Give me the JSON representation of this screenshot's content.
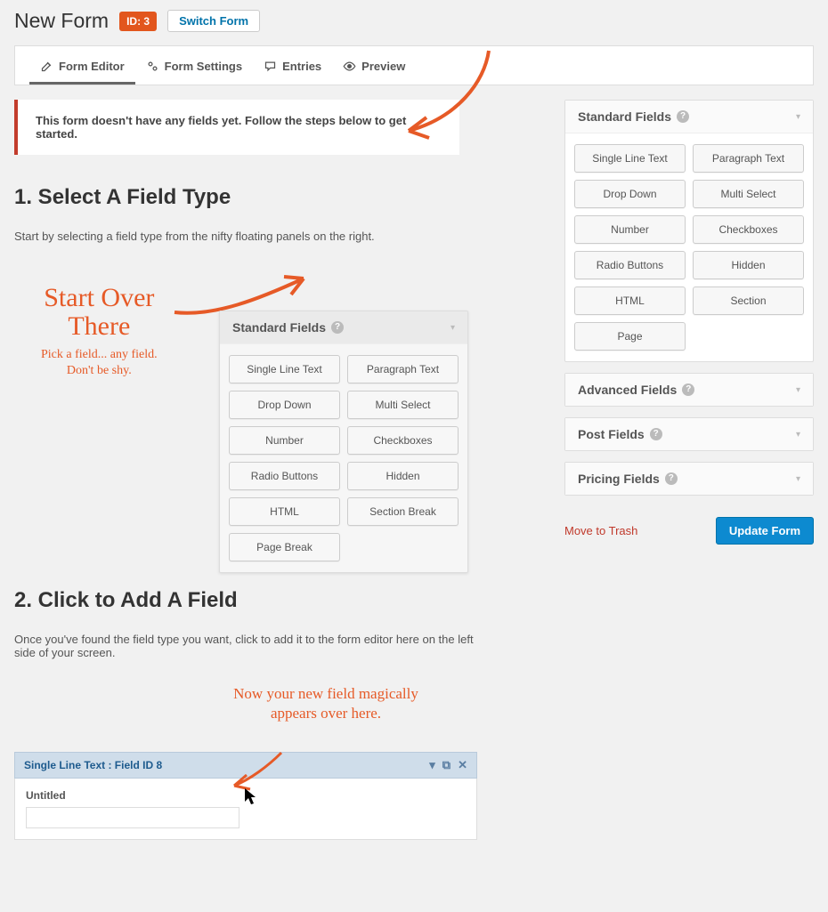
{
  "header": {
    "title": "New Form",
    "id_badge": "ID: 3",
    "switch_form": "Switch Form"
  },
  "tabs": {
    "editor": "Form Editor",
    "settings": "Form Settings",
    "entries": "Entries",
    "preview": "Preview"
  },
  "notice": "This form doesn't have any fields yet. Follow the steps below to get started.",
  "step1": {
    "heading": "1. Select A Field Type",
    "desc": "Start by selecting a field type from the nifty floating panels on the right.",
    "hand_big1": "Start Over",
    "hand_big2": "There",
    "hand_small1": "Pick a field... any field.",
    "hand_small2": "Don't be shy."
  },
  "step2": {
    "heading": "2. Click to Add A Field",
    "desc": "Once you've found the field type you want, click to add it to the form editor here on the left side of your screen.",
    "hand1": "Now your new field magically",
    "hand2": "appears over here."
  },
  "demo_panel": {
    "title": "Standard Fields",
    "items": [
      "Single Line Text",
      "Paragraph Text",
      "Drop Down",
      "Multi Select",
      "Number",
      "Checkboxes",
      "Radio Buttons",
      "Hidden",
      "HTML",
      "Section Break",
      "Page Break"
    ]
  },
  "field_demo": {
    "header": "Single Line Text : Field ID 8",
    "label": "Untitled"
  },
  "sidebar": {
    "standard": {
      "title": "Standard Fields",
      "items": [
        "Single Line Text",
        "Paragraph Text",
        "Drop Down",
        "Multi Select",
        "Number",
        "Checkboxes",
        "Radio Buttons",
        "Hidden",
        "HTML",
        "Section",
        "Page"
      ]
    },
    "advanced": {
      "title": "Advanced Fields"
    },
    "post": {
      "title": "Post Fields"
    },
    "pricing": {
      "title": "Pricing Fields"
    }
  },
  "actions": {
    "trash": "Move to Trash",
    "update": "Update Form"
  }
}
